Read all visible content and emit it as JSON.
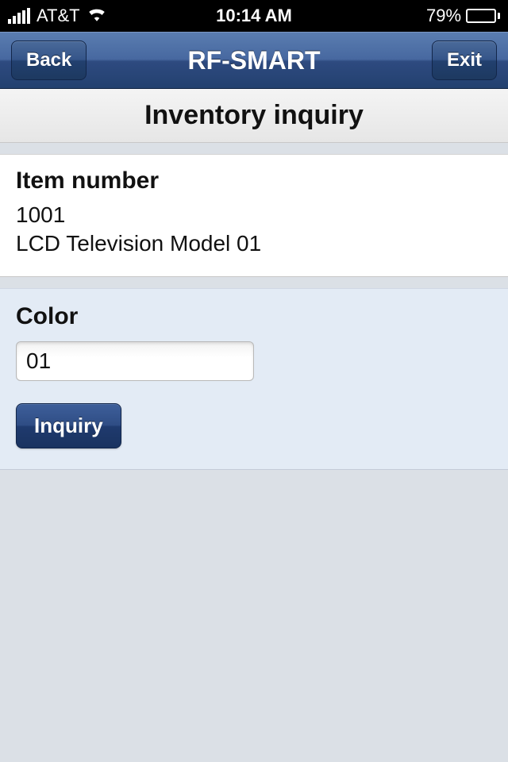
{
  "status": {
    "carrier": "AT&T",
    "time": "10:14 AM",
    "battery_pct": "79%"
  },
  "nav": {
    "back_label": "Back",
    "title": "RF-SMART",
    "exit_label": "Exit"
  },
  "page": {
    "title": "Inventory inquiry"
  },
  "item": {
    "label": "Item number",
    "number": "1001",
    "description": "LCD Television Model 01"
  },
  "color": {
    "label": "Color",
    "value": "01"
  },
  "buttons": {
    "inquiry_label": "Inquiry"
  }
}
